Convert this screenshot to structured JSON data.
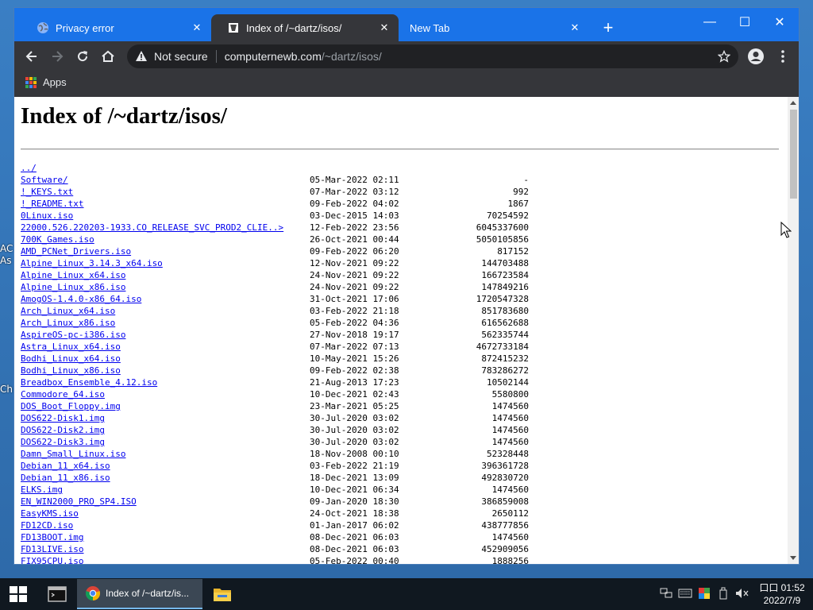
{
  "desktop": {
    "frag1": "AC",
    "frag2": "As",
    "frag3": "Ch"
  },
  "tabs": [
    {
      "label": "Privacy error",
      "close": "✕"
    },
    {
      "label": "Index of /~dartz/isos/",
      "close": "✕"
    },
    {
      "label": "New Tab",
      "close": "✕"
    }
  ],
  "new_tab": "+",
  "window_controls": {
    "minimize": "—",
    "maximize": "☐",
    "close": "✕"
  },
  "omnibox": {
    "security": "Not secure",
    "host": "computernewb.com",
    "path": "/~dartz/isos/"
  },
  "bookmarks": {
    "apps": "Apps"
  },
  "page": {
    "title": "Index of /~dartz/isos/",
    "rows": [
      {
        "name": "../",
        "date": "",
        "size": ""
      },
      {
        "name": "Software/",
        "date": "05-Mar-2022 02:11",
        "size": "-"
      },
      {
        "name": "!_KEYS.txt",
        "date": "07-Mar-2022 03:12",
        "size": "992"
      },
      {
        "name": "!_README.txt",
        "date": "09-Feb-2022 04:02",
        "size": "1867"
      },
      {
        "name": "0Linux.iso",
        "date": "03-Dec-2015 14:03",
        "size": "70254592"
      },
      {
        "name": "22000.526.220203-1933.CO_RELEASE_SVC_PROD2_CLIE..>",
        "date": "12-Feb-2022 23:56",
        "size": "6045337600"
      },
      {
        "name": "700K_Games.iso",
        "date": "26-Oct-2021 00:44",
        "size": "5050105856"
      },
      {
        "name": "AMD_PCNet_Drivers.iso",
        "date": "09-Feb-2022 06:20",
        "size": "817152"
      },
      {
        "name": "Alpine_Linux_3.14.3_x64.iso",
        "date": "12-Nov-2021 09:22",
        "size": "144703488"
      },
      {
        "name": "Alpine_Linux_x64.iso",
        "date": "24-Nov-2021 09:22",
        "size": "166723584"
      },
      {
        "name": "Alpine_Linux_x86.iso",
        "date": "24-Nov-2021 09:22",
        "size": "147849216"
      },
      {
        "name": "AmogOS-1.4.0-x86_64.iso",
        "date": "31-Oct-2021 17:06",
        "size": "1720547328"
      },
      {
        "name": "Arch_Linux_x64.iso",
        "date": "03-Feb-2022 21:18",
        "size": "851783680"
      },
      {
        "name": "Arch_Linux_x86.iso",
        "date": "05-Feb-2022 04:36",
        "size": "616562688"
      },
      {
        "name": "AspireOS-pc-i386.iso",
        "date": "27-Nov-2018 19:17",
        "size": "562335744"
      },
      {
        "name": "Astra_Linux_x64.iso",
        "date": "07-Mar-2022 07:13",
        "size": "4672733184"
      },
      {
        "name": "Bodhi_Linux_x64.iso",
        "date": "10-May-2021 15:26",
        "size": "872415232"
      },
      {
        "name": "Bodhi_Linux_x86.iso",
        "date": "09-Feb-2022 02:38",
        "size": "783286272"
      },
      {
        "name": "Breadbox_Ensemble_4.12.iso",
        "date": "21-Aug-2013 17:23",
        "size": "10502144"
      },
      {
        "name": "Commodore_64.iso",
        "date": "10-Dec-2021 02:43",
        "size": "5580800"
      },
      {
        "name": "DOS_Boot_Floppy.img",
        "date": "23-Mar-2021 05:25",
        "size": "1474560"
      },
      {
        "name": "DOS622-Disk1.img",
        "date": "30-Jul-2020 03:02",
        "size": "1474560"
      },
      {
        "name": "DOS622-Disk2.img",
        "date": "30-Jul-2020 03:02",
        "size": "1474560"
      },
      {
        "name": "DOS622-Disk3.img",
        "date": "30-Jul-2020 03:02",
        "size": "1474560"
      },
      {
        "name": "Damn_Small_Linux.iso",
        "date": "18-Nov-2008 00:10",
        "size": "52328448"
      },
      {
        "name": "Debian_11_x64.iso",
        "date": "03-Feb-2022 21:19",
        "size": "396361728"
      },
      {
        "name": "Debian_11_x86.iso",
        "date": "18-Dec-2021 13:09",
        "size": "492830720"
      },
      {
        "name": "ELKS.img",
        "date": "10-Dec-2021 06:34",
        "size": "1474560"
      },
      {
        "name": "EN_WIN2000_PRO_SP4.ISO",
        "date": "09-Jan-2020 18:30",
        "size": "386859008"
      },
      {
        "name": "EasyKMS.iso",
        "date": "24-Oct-2021 18:38",
        "size": "2650112"
      },
      {
        "name": "FD12CD.iso",
        "date": "01-Jan-2017 06:02",
        "size": "438777856"
      },
      {
        "name": "FD13BOOT.img",
        "date": "08-Dec-2021 06:03",
        "size": "1474560"
      },
      {
        "name": "FD13LIVE.iso",
        "date": "08-Dec-2021 06:03",
        "size": "452909056"
      },
      {
        "name": "FIX95CPU.iso",
        "date": "05-Feb-2022 00:40",
        "size": "1888256"
      }
    ]
  },
  "taskbar": {
    "chrome_item": "Index of /~dartz/is...",
    "time": "口口 01:52",
    "date": "2022/7/9"
  },
  "colors": {
    "tabstrip": "#1a73e8",
    "toolbar": "#35363a",
    "link": "#0000ee",
    "taskbar": "#101820"
  }
}
